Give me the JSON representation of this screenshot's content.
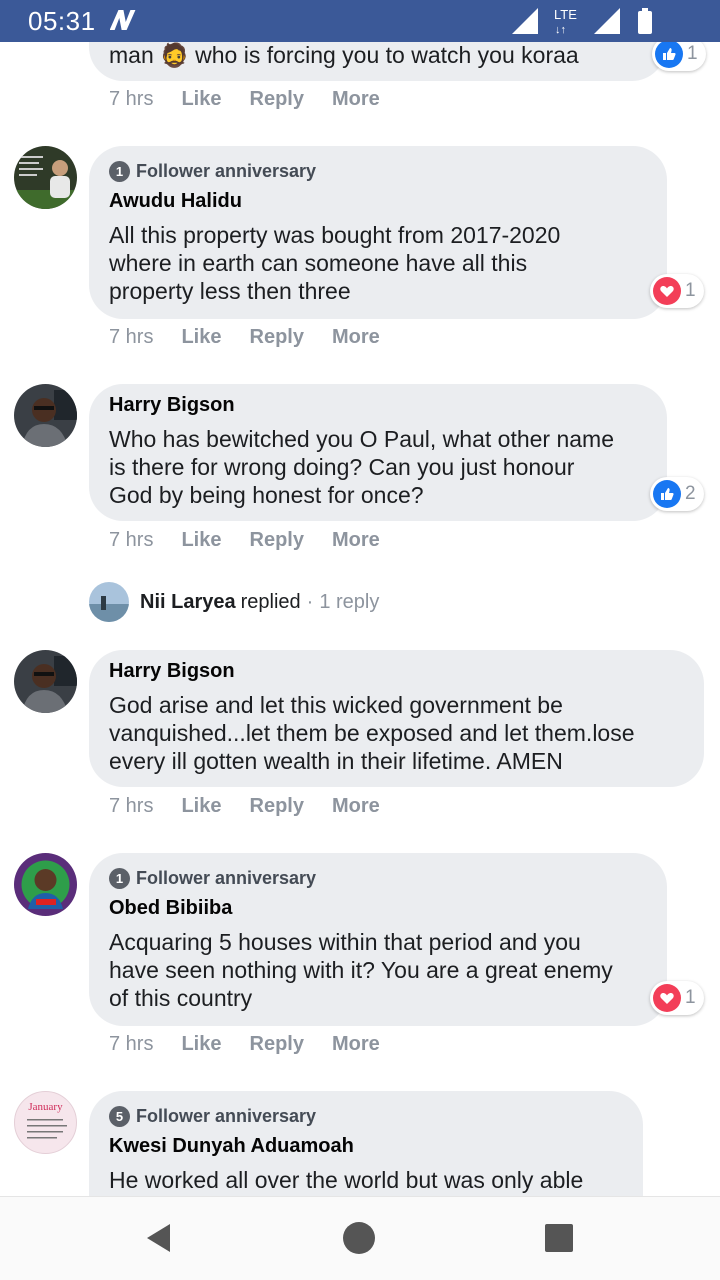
{
  "status_bar": {
    "time": "05:31",
    "network": "LTE"
  },
  "comments": [
    {
      "id": "c0",
      "text_tail": "man 🧔 who is forcing you to watch you koraa",
      "time": "7 hrs",
      "like": "Like",
      "reply": "Reply",
      "more": "More",
      "reaction": {
        "type": "like",
        "count": "1"
      }
    },
    {
      "id": "c1",
      "badge_num": "1",
      "badge": "Follower anniversary",
      "author": "Awudu Halidu",
      "text": "All this property was bought from 2017-2020\nwhere in earth can someone have all this\nproperty less then three",
      "time": "7 hrs",
      "like": "Like",
      "reply": "Reply",
      "more": "More",
      "reaction": {
        "type": "love",
        "count": "1"
      }
    },
    {
      "id": "c2",
      "author": "Harry Bigson",
      "text": "Who has bewitched you O Paul, what other name\nis there for wrong doing? Can you just honour\nGod by being honest for once?",
      "time": "7 hrs",
      "like": "Like",
      "reply": "Reply",
      "more": "More",
      "reaction": {
        "type": "like",
        "count": "2"
      }
    },
    {
      "id": "c3",
      "author": "Harry Bigson",
      "text": "God arise and let this wicked government be\nvanquished...let them be exposed and let them.lose\nevery ill gotten wealth in their lifetime. AMEN",
      "time": "7 hrs",
      "like": "Like",
      "reply": "Reply",
      "more": "More"
    },
    {
      "id": "c4",
      "badge_num": "1",
      "badge": "Follower anniversary",
      "author": "Obed Bibiiba",
      "text": "Acquaring 5 houses within that period and you\nhave seen nothing with it? You are a great enemy\nof this country",
      "time": "7 hrs",
      "like": "Like",
      "reply": "Reply",
      "more": "More",
      "reaction": {
        "type": "love",
        "count": "1"
      }
    },
    {
      "id": "c5",
      "badge_num": "5",
      "badge": "Follower anniversary",
      "author": "Kwesi Dunyah Aduamoah",
      "text": "He worked all over the world but was only able",
      "avatar_text": "January"
    }
  ],
  "replied": {
    "name": "Nii Laryea",
    "verb": "replied",
    "dot": "·",
    "count": "1 reply"
  },
  "colors": {
    "brand": "#3b5998",
    "like": "#1877f2",
    "love": "#f33e58",
    "bubble": "#ebedf0"
  }
}
